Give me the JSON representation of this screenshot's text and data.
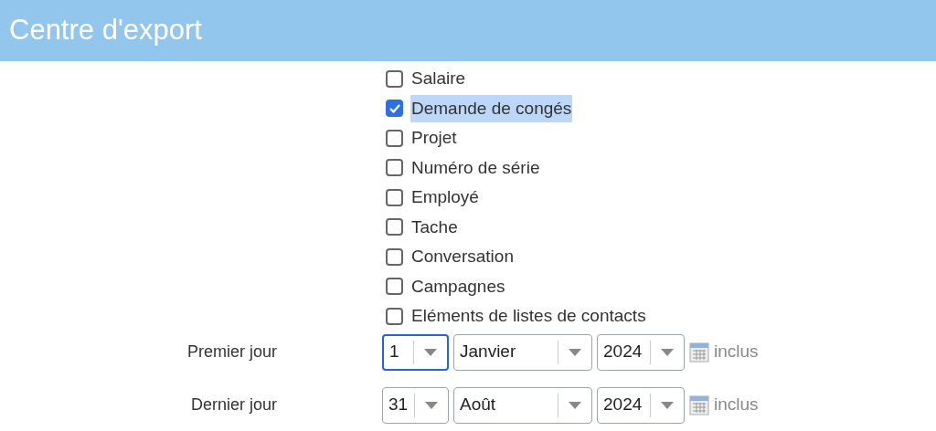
{
  "header": {
    "title": "Centre d'export"
  },
  "export_types": [
    {
      "label": "Salaire",
      "checked": false,
      "selected": false
    },
    {
      "label": "Demande de congés",
      "checked": true,
      "selected": true
    },
    {
      "label": "Projet",
      "checked": false,
      "selected": false
    },
    {
      "label": "Numéro de série",
      "checked": false,
      "selected": false
    },
    {
      "label": "Employé",
      "checked": false,
      "selected": false
    },
    {
      "label": "Tache",
      "checked": false,
      "selected": false
    },
    {
      "label": "Conversation",
      "checked": false,
      "selected": false
    },
    {
      "label": "Campagnes",
      "checked": false,
      "selected": false
    },
    {
      "label": "Eléments de listes de contacts",
      "checked": false,
      "selected": false
    }
  ],
  "date_rows": [
    {
      "label": "Premier jour",
      "day": "1",
      "day_focused": true,
      "month": "Janvier",
      "year": "2024",
      "suffix": "inclus"
    },
    {
      "label": "Dernier jour",
      "day": "31",
      "day_focused": false,
      "month": "Août",
      "year": "2024",
      "suffix": "inclus"
    }
  ]
}
